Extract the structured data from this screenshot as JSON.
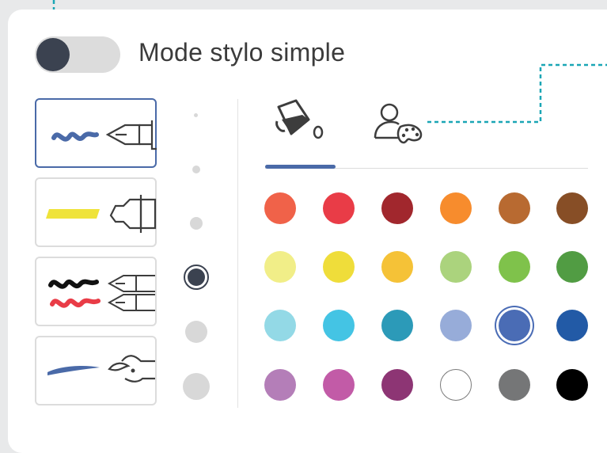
{
  "toggle": {
    "label": "Mode stylo simple",
    "checked": false
  },
  "tools": [
    {
      "name": "pen",
      "selected": true
    },
    {
      "name": "highlighter",
      "selected": false
    },
    {
      "name": "double-pen",
      "selected": false
    },
    {
      "name": "brush",
      "selected": false
    }
  ],
  "sizes": {
    "count": 6,
    "selected_index": 3
  },
  "tabs": [
    {
      "name": "fill-color-tab",
      "icon": "paint-bucket-icon",
      "selected": true
    },
    {
      "name": "custom-color-tab",
      "icon": "user-palette-icon",
      "selected": false
    }
  ],
  "colors": [
    "#f06249",
    "#e93c47",
    "#a1272d",
    "#f78c2d",
    "#b86a31",
    "#874e26",
    "#f1ee88",
    "#efdd3a",
    "#f5c237",
    "#abd37d",
    "#7fc24b",
    "#519c43",
    "#93d9e6",
    "#44c4e4",
    "#2c9ab8",
    "#97acd9",
    "#4a6cb5",
    "#225aa6",
    "#b47eb8",
    "#c25ba7",
    "#8d3574",
    "#ffffff",
    "#757677",
    "#000000"
  ],
  "selected_color": "#4a6cb5",
  "accent": "#4a6aa8",
  "dashed_color": "#1aa6b5"
}
